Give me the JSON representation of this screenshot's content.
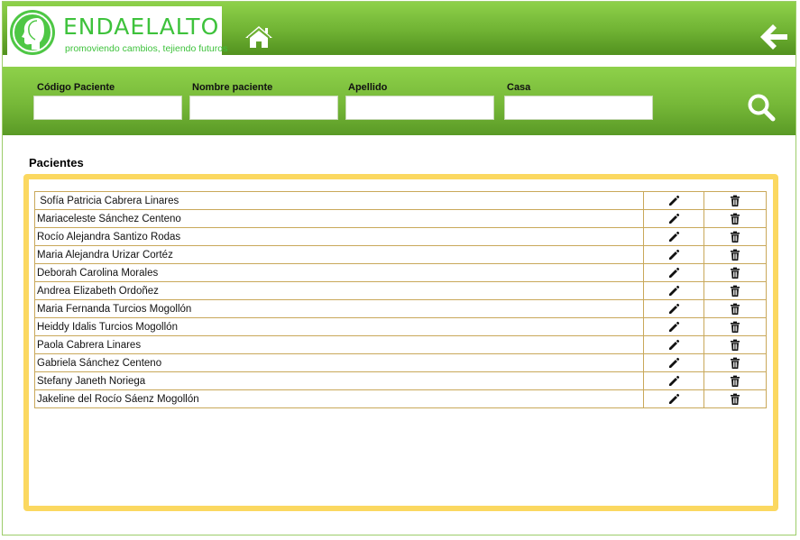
{
  "brand": {
    "name": "ENDAELALTO",
    "tagline": "promoviendo cambios, tejiendo futuros"
  },
  "colors": {
    "header_green": "#6fb233",
    "logo_green": "#3ec23c",
    "box_yellow": "#fbd860",
    "table_border": "#c9a85a"
  },
  "header": {
    "home_icon": "home-icon",
    "back_icon": "arrow-left-icon"
  },
  "search": {
    "fields": [
      {
        "label": "Código Paciente",
        "value": ""
      },
      {
        "label": "Nombre paciente",
        "value": ""
      },
      {
        "label": "Apellido",
        "value": ""
      },
      {
        "label": "Casa",
        "value": ""
      }
    ],
    "search_icon": "search-icon"
  },
  "section": {
    "title": "Pacientes"
  },
  "patients": [
    " Sofía Patricia Cabrera Linares",
    "Mariaceleste Sánchez Centeno",
    "Rocío Alejandra Santizo Rodas",
    "Maria Alejandra Urizar Cortéz",
    "Deborah Carolina Morales",
    "Andrea Elizabeth Ordoñez",
    "Maria Fernanda Turcios Mogollón",
    "Heiddy Idalis Turcios Mogollón",
    "Paola Cabrera Linares",
    "Gabriela Sánchez Centeno",
    "Stefany Janeth Noriega",
    "Jakeline del Rocío Sáenz Mogollón"
  ],
  "row_actions": {
    "edit_icon": "pencil-icon",
    "delete_icon": "trash-icon"
  }
}
